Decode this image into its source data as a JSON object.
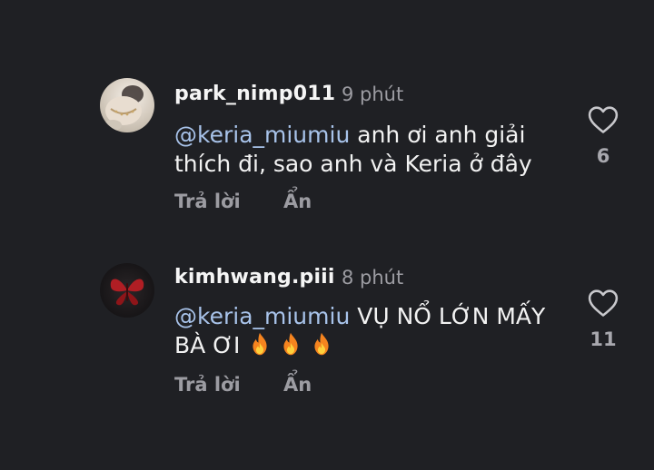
{
  "comments": [
    {
      "username": "park_nimp011",
      "time": "9 phút",
      "mention": "@keria_miumiu",
      "text": " anh ơi anh giải thích đi, sao anh và Keria ở đây",
      "reply_label": "Trả lời",
      "hide_label": "Ẩn",
      "like_count": "6",
      "avatar": "avatar-photo-light"
    },
    {
      "username": "kimhwang.piii",
      "time": "8 phút",
      "mention": "@keria_miumiu",
      "text": " VỤ NỔ LỚN MẤY BÀ ƠI",
      "emoji": [
        "fire-emoji",
        "fire-emoji",
        "fire-emoji"
      ],
      "reply_label": "Trả lời",
      "hide_label": "Ẩn",
      "like_count": "11",
      "avatar": "avatar-red-butterfly"
    }
  ],
  "colors": {
    "background": "#1f2024",
    "mention": "#a8c3ea",
    "secondary_text": "#9c9ca2"
  }
}
